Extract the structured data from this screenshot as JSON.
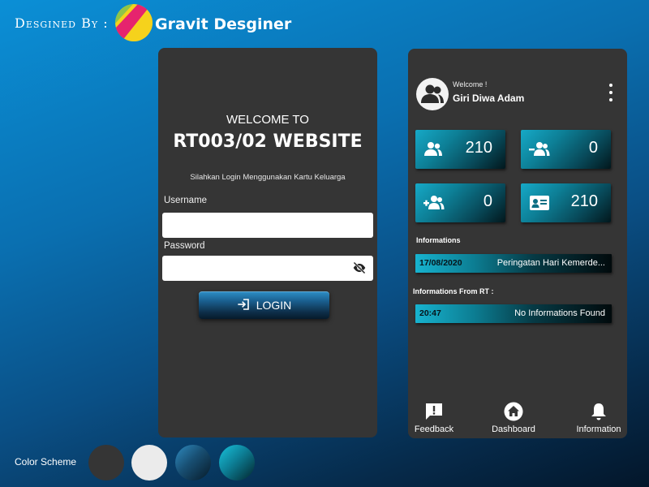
{
  "header": {
    "designed_by": "Desgined By :",
    "brand": "Gravit Desginer"
  },
  "login": {
    "welcome": "WELCOME TO",
    "title": "RT003/02 WEBSITE",
    "instruction": "Silahkan Login Menggunakan Kartu Keluarga",
    "username_label": "Username",
    "username_value": "",
    "password_label": "Password",
    "password_value": "",
    "login_label": "LOGIN"
  },
  "dashboard": {
    "welcome": "Welcome !",
    "user_name": "Giri Diwa Adam",
    "stats": [
      {
        "icon": "users-icon",
        "value": "210"
      },
      {
        "icon": "remove-user-icon",
        "value": "0"
      },
      {
        "icon": "add-user-icon",
        "value": "0"
      },
      {
        "icon": "id-card-icon",
        "value": "210"
      }
    ],
    "informations_label": "Informations",
    "informations": [
      {
        "date": "17/08/2020",
        "message": "Peringatan Hari Kemerde..."
      }
    ],
    "rt_label": "Informations From RT :",
    "rt_informations": [
      {
        "time": "20:47",
        "message": "No Informations Found"
      }
    ],
    "nav": {
      "feedback": "Feedback",
      "dashboard": "Dashboard",
      "information": "Information"
    }
  },
  "footer": {
    "color_scheme_label": "Color Scheme",
    "colors": [
      "#353535",
      "#ebebeb",
      "#1e5f8a",
      "#0d8fa6"
    ]
  }
}
